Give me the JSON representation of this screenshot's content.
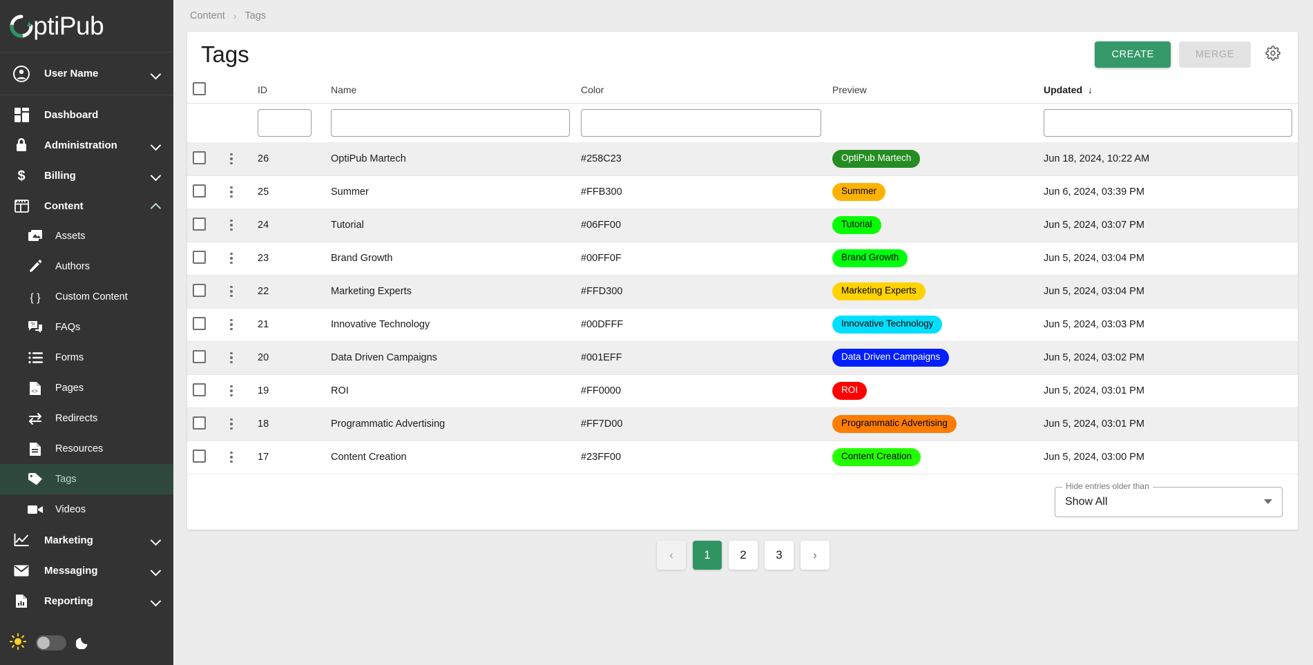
{
  "brand": {
    "name": "OptiPub",
    "accent": "#2e9462",
    "logo_icon": "circular-arrow-logo"
  },
  "sidebar": {
    "user": {
      "label": "User Name",
      "icon": "account-circle-icon",
      "chevron": "chevron-down-icon"
    },
    "items": [
      {
        "label": "Dashboard",
        "icon": "dashboard-icon",
        "expandable": false,
        "active": false,
        "sub": false
      },
      {
        "label": "Administration",
        "icon": "lock-icon",
        "expandable": true,
        "active": false,
        "sub": false
      },
      {
        "label": "Billing",
        "icon": "dollar-icon",
        "expandable": true,
        "active": false,
        "sub": false
      },
      {
        "label": "Content",
        "icon": "content-layout-icon",
        "expandable": true,
        "expanded": true,
        "active": false,
        "sub": false
      },
      {
        "label": "Assets",
        "icon": "image-stack-icon",
        "expandable": false,
        "active": false,
        "sub": true
      },
      {
        "label": "Authors",
        "icon": "pencil-icon",
        "expandable": false,
        "active": false,
        "sub": true
      },
      {
        "label": "Custom Content",
        "icon": "braces-icon",
        "expandable": false,
        "active": false,
        "sub": true
      },
      {
        "label": "FAQs",
        "icon": "faq-bubble-icon",
        "expandable": false,
        "active": false,
        "sub": true
      },
      {
        "label": "Forms",
        "icon": "list-icon",
        "expandable": false,
        "active": false,
        "sub": true
      },
      {
        "label": "Pages",
        "icon": "page-code-icon",
        "expandable": false,
        "active": false,
        "sub": true
      },
      {
        "label": "Redirects",
        "icon": "redirect-arrows-icon",
        "expandable": false,
        "active": false,
        "sub": true
      },
      {
        "label": "Resources",
        "icon": "document-icon",
        "expandable": false,
        "active": false,
        "sub": true
      },
      {
        "label": "Tags",
        "icon": "tag-icon",
        "expandable": false,
        "active": true,
        "sub": true
      },
      {
        "label": "Videos",
        "icon": "video-camera-icon",
        "expandable": false,
        "active": false,
        "sub": true
      },
      {
        "label": "Marketing",
        "icon": "line-chart-icon",
        "expandable": true,
        "active": false,
        "sub": false
      },
      {
        "label": "Messaging",
        "icon": "envelope-icon",
        "expandable": true,
        "active": false,
        "sub": false
      },
      {
        "label": "Reporting",
        "icon": "report-chart-icon",
        "expandable": true,
        "active": false,
        "sub": false
      }
    ],
    "theme_toggle": {
      "light_icon": "sun-icon",
      "dark_icon": "moon-icon",
      "state": "light"
    }
  },
  "breadcrumb": {
    "items": [
      "Content",
      "Tags"
    ],
    "separator": "›"
  },
  "header": {
    "title": "Tags",
    "create_label": "CREATE",
    "merge_label": "MERGE",
    "settings_icon": "gear-icon"
  },
  "table": {
    "columns": [
      {
        "key": "id",
        "label": "ID"
      },
      {
        "key": "name",
        "label": "Name"
      },
      {
        "key": "color",
        "label": "Color"
      },
      {
        "key": "preview",
        "label": "Preview"
      },
      {
        "key": "updated",
        "label": "Updated",
        "sorted": true,
        "sort_dir": "desc",
        "sort_icon": "arrow-down-icon"
      }
    ],
    "filters": {
      "id": "",
      "name": "",
      "color": "",
      "updated": ""
    },
    "rows": [
      {
        "id": "26",
        "name": "OptiPub Martech",
        "color": "#258C23",
        "preview": "OptiPub Martech",
        "text_color": "#ffffff",
        "updated": "Jun 18, 2024, 10:22 AM"
      },
      {
        "id": "25",
        "name": "Summer",
        "color": "#FFB300",
        "preview": "Summer",
        "text_color": "#000000",
        "updated": "Jun 6, 2024, 03:39 PM"
      },
      {
        "id": "24",
        "name": "Tutorial",
        "color": "#06FF00",
        "preview": "Tutorial",
        "text_color": "#000000",
        "updated": "Jun 5, 2024, 03:07 PM"
      },
      {
        "id": "23",
        "name": "Brand Growth",
        "color": "#00FF0F",
        "preview": "Brand Growth",
        "text_color": "#000000",
        "updated": "Jun 5, 2024, 03:04 PM"
      },
      {
        "id": "22",
        "name": "Marketing Experts",
        "color": "#FFD300",
        "preview": "Marketing Experts",
        "text_color": "#000000",
        "updated": "Jun 5, 2024, 03:04 PM"
      },
      {
        "id": "21",
        "name": "Innovative Technology",
        "color": "#00DFFF",
        "preview": "Innovative Technology",
        "text_color": "#000000",
        "updated": "Jun 5, 2024, 03:03 PM"
      },
      {
        "id": "20",
        "name": "Data Driven Campaigns",
        "color": "#001EFF",
        "preview": "Data Driven Campaigns",
        "text_color": "#ffffff",
        "updated": "Jun 5, 2024, 03:02 PM"
      },
      {
        "id": "19",
        "name": "ROI",
        "color": "#FF0000",
        "preview": "ROI",
        "text_color": "#ffffff",
        "updated": "Jun 5, 2024, 03:01 PM"
      },
      {
        "id": "18",
        "name": "Programmatic Advertising",
        "color": "#FF7D00",
        "preview": "Programmatic Advertising",
        "text_color": "#000000",
        "updated": "Jun 5, 2024, 03:01 PM"
      },
      {
        "id": "17",
        "name": "Content Creation",
        "color": "#23FF00",
        "preview": "Content Creation",
        "text_color": "#000000",
        "updated": "Jun 5, 2024, 03:00 PM"
      }
    ]
  },
  "age_filter": {
    "label": "Hide entries older than",
    "value": "Show All"
  },
  "pagination": {
    "prev_icon": "chevron-left-icon",
    "next_icon": "chevron-right-icon",
    "pages": [
      "1",
      "2",
      "3"
    ],
    "current": "1"
  }
}
